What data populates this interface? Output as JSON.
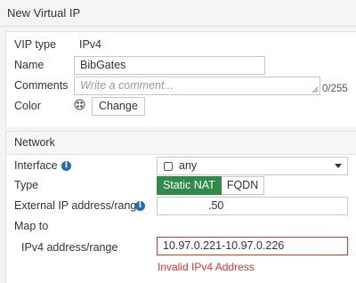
{
  "window": {
    "title": "New Virtual IP"
  },
  "general": {
    "vip_type_label": "VIP type",
    "vip_type_value": "IPv4",
    "name_label": "Name",
    "name_value": "BibGates",
    "comments_label": "Comments",
    "comments_placeholder": "Write a comment...",
    "comments_counter": "0/255",
    "color_label": "Color",
    "color_button": "Change"
  },
  "network": {
    "title": "Network",
    "interface_label": "Interface",
    "interface_value": "any",
    "type_label": "Type",
    "type_options": [
      "Static NAT",
      "FQDN"
    ],
    "type_selected": "Static NAT",
    "external_label": "External IP address/range",
    "external_value": ".50",
    "mapto_label": "Map to",
    "ipv4_label": "IPv4 address/range",
    "ipv4_value": "10.97.0.221-10.97.0.226",
    "ipv4_error": "Invalid IPv4 Address"
  },
  "colors": {
    "accent_green": "#2f8b47",
    "error_red": "#d33333",
    "info_blue": "#1f6fb2"
  }
}
